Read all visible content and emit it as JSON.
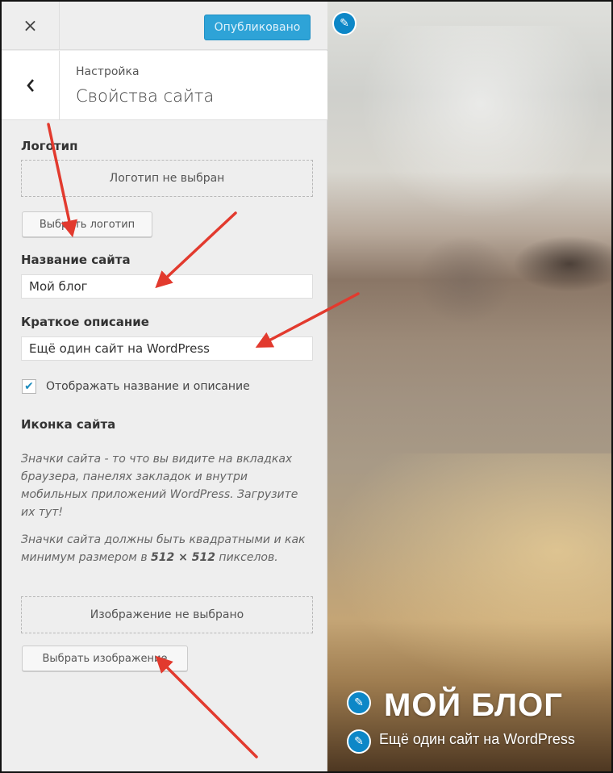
{
  "topbar": {
    "close_icon": "×",
    "publish_label": "Опубликовано"
  },
  "header": {
    "back_icon": "‹",
    "subtitle": "Настройка",
    "title": "Свойства сайта"
  },
  "logo": {
    "label": "Логотип",
    "empty_text": "Логотип не выбран",
    "button": "Выбрать логотип"
  },
  "site_title": {
    "label": "Название сайта",
    "value": "Мой блог"
  },
  "tagline": {
    "label": "Краткое описание",
    "value": "Ещё один сайт на WordPress"
  },
  "display": {
    "checked": true,
    "check_icon": "✔",
    "label": "Отображать название и описание"
  },
  "site_icon": {
    "label": "Иконка сайта",
    "desc1": "Значки сайта - то что вы видите на вкладках браузера, панелях закладок и внутри мобильных приложений WordPress. Загрузите их тут!",
    "desc2_prefix": "Значки сайта должны быть квадратными и как минимум размером в",
    "desc2_size": "512 × 512",
    "desc2_suffix": "пикселов.",
    "empty_text": "Изображение не выбрано",
    "button": "Выбрать изображение"
  },
  "preview": {
    "edit_icon": "✎",
    "site_title": "МОЙ БЛОГ",
    "site_desc": "Ещё один сайт на WordPress"
  },
  "colors": {
    "accent": "#2ea3d7",
    "edit_dot": "#0d87c7",
    "arrow": "#e23a2e"
  }
}
